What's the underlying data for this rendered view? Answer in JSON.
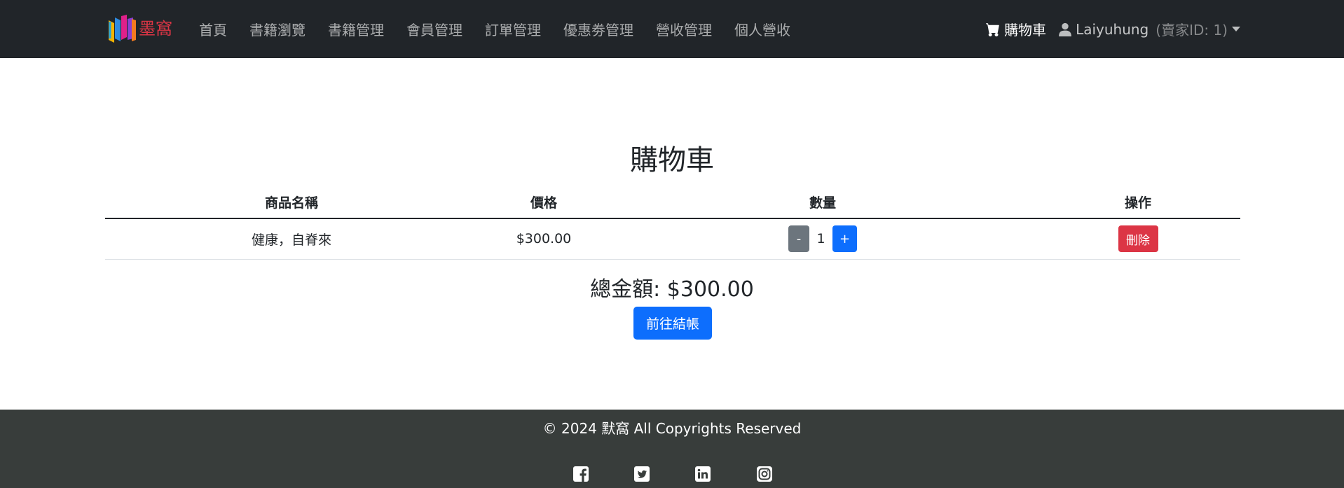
{
  "brand": {
    "name": "墨窩",
    "logo_icon": "book-logo-icon",
    "brand_color": "#dc3545"
  },
  "nav": {
    "items": [
      {
        "label": "首頁"
      },
      {
        "label": "書籍瀏覽"
      },
      {
        "label": "書籍管理"
      },
      {
        "label": "會員管理"
      },
      {
        "label": "訂單管理"
      },
      {
        "label": "優惠劵管理"
      },
      {
        "label": "營收管理"
      },
      {
        "label": "個人營收"
      }
    ],
    "cart_label": "購物車",
    "cart_icon": "shopping-cart-icon",
    "user_icon": "user-icon",
    "user_name": "Laiyuhung",
    "seller_id": "(賣家ID: 1)"
  },
  "main": {
    "title": "購物車",
    "table": {
      "headers": [
        "商品名稱",
        "價格",
        "數量",
        "操作"
      ],
      "rows": [
        {
          "name": "健康，自脊來",
          "price": "$300.00",
          "quantity": "1",
          "minus_label": "-",
          "plus_label": "+",
          "delete_label": "刪除"
        }
      ]
    },
    "total_label": "總金額: $300.00",
    "checkout_label": "前往結帳"
  },
  "footer": {
    "copyright": "© 2024 默窩 All Copyrights Reserved",
    "social_icons": [
      "facebook-icon",
      "twitter-icon",
      "linkedin-icon",
      "instagram-icon"
    ]
  },
  "colors": {
    "navbar_bg": "#212529",
    "footer_bg": "#383d3b",
    "primary": "#0d6efd",
    "danger": "#dc3545",
    "secondary": "#6c757d"
  }
}
